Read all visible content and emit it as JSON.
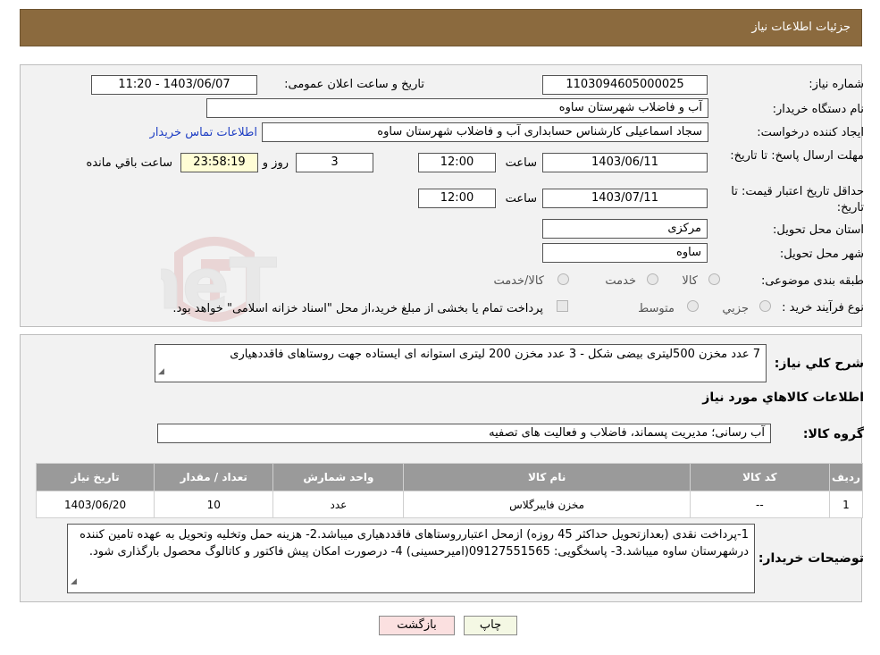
{
  "header": {
    "title": "جزئیات اطلاعات نیاز"
  },
  "labels": {
    "need_number": "شماره نیاز:",
    "announce_datetime": "تاریخ و ساعت اعلان عمومی:",
    "buyer_org": "نام دستگاه خریدار:",
    "requester": "ایجاد کننده درخواست:",
    "buyer_contact": "اطلاعات تماس خریدار",
    "deadline": "مهلت ارسال پاسخ: تا تاریخ:",
    "price_validity": "حداقل تاریخ اعتبار قیمت: تا تاریخ:",
    "time_word": "ساعت",
    "day_and": "روز و",
    "remaining": "ساعت باقي مانده",
    "province": "استان محل تحویل:",
    "city": "شهر محل تحویل:",
    "category": "طبقه بندی موضوعی:",
    "purchase_type": "نوع فرآیند خرید :",
    "need_desc": "شرح كلي نياز:",
    "goods_info": "اطلاعات كالاهاي مورد نياز",
    "goods_group": "گروه كالا:",
    "buyer_notes": "توضیحات خریدار:"
  },
  "values": {
    "need_number": "1103094605000025",
    "announce_datetime": "1403/06/07 - 11:20",
    "buyer_org": "آب و فاضلاب شهرستان ساوه",
    "requester": "سجاد اسماعیلی کارشناس حسابداری آب و فاضلاب شهرستان ساوه",
    "deadline_date": "1403/06/11",
    "deadline_time": "12:00",
    "days": "3",
    "remaining_time": "23:58:19",
    "validity_date": "1403/07/11",
    "validity_time": "12:00",
    "province": "مرکزی",
    "city": "ساوه",
    "need_desc": "7 عدد مخزن 500لیتری بیضی شکل - 3 عدد مخزن 200 لیتری استوانه ای ایستاده جهت روستاهای فاقددهیاری",
    "goods_group": "آب رسانی؛ مدیریت پسماند، فاضلاب و فعالیت های تصفیه",
    "buyer_notes": "1-پرداخت  نقدی (بعدازتحویل حداکثر 45 روزه) ازمحل اعتبارروستاهای فاقددهیاری میباشد.2- هزینه حمل وتخلیه وتحویل به عهده تامین کننده درشهرستان ساوه میباشد.3- پاسخگویی: 09127551565(امیرحسینی) 4- درصورت امکان پیش فاکتور و کاتالوگ محصول بارگذاری شود."
  },
  "category_options": [
    "کالا",
    "خدمت",
    "کالا/خدمت"
  ],
  "purchase_options": [
    "جزيي",
    "متوسط"
  ],
  "purchase_note": "پرداخت تمام یا بخشی از مبلغ خرید،از محل \"اسناد خزانه اسلامی\" خواهد بود.",
  "table": {
    "headers": [
      "رديف",
      "کد کالا",
      "نام کالا",
      "واحد شمارش",
      "تعداد / مقدار",
      "تاریخ نیاز"
    ],
    "rows": [
      [
        "1",
        "--",
        "مخزن فایبرگلاس",
        "عدد",
        "10",
        "1403/06/20"
      ]
    ]
  },
  "buttons": {
    "print": "چاپ",
    "back": "بازگشت"
  },
  "watermark": {
    "text": "AriaTender.neT"
  },
  "colors": {
    "header": "#8b6a3e",
    "link": "#1f3fc4",
    "yellow_box": "#fffdd5",
    "table_header": "#9a9a9a"
  }
}
